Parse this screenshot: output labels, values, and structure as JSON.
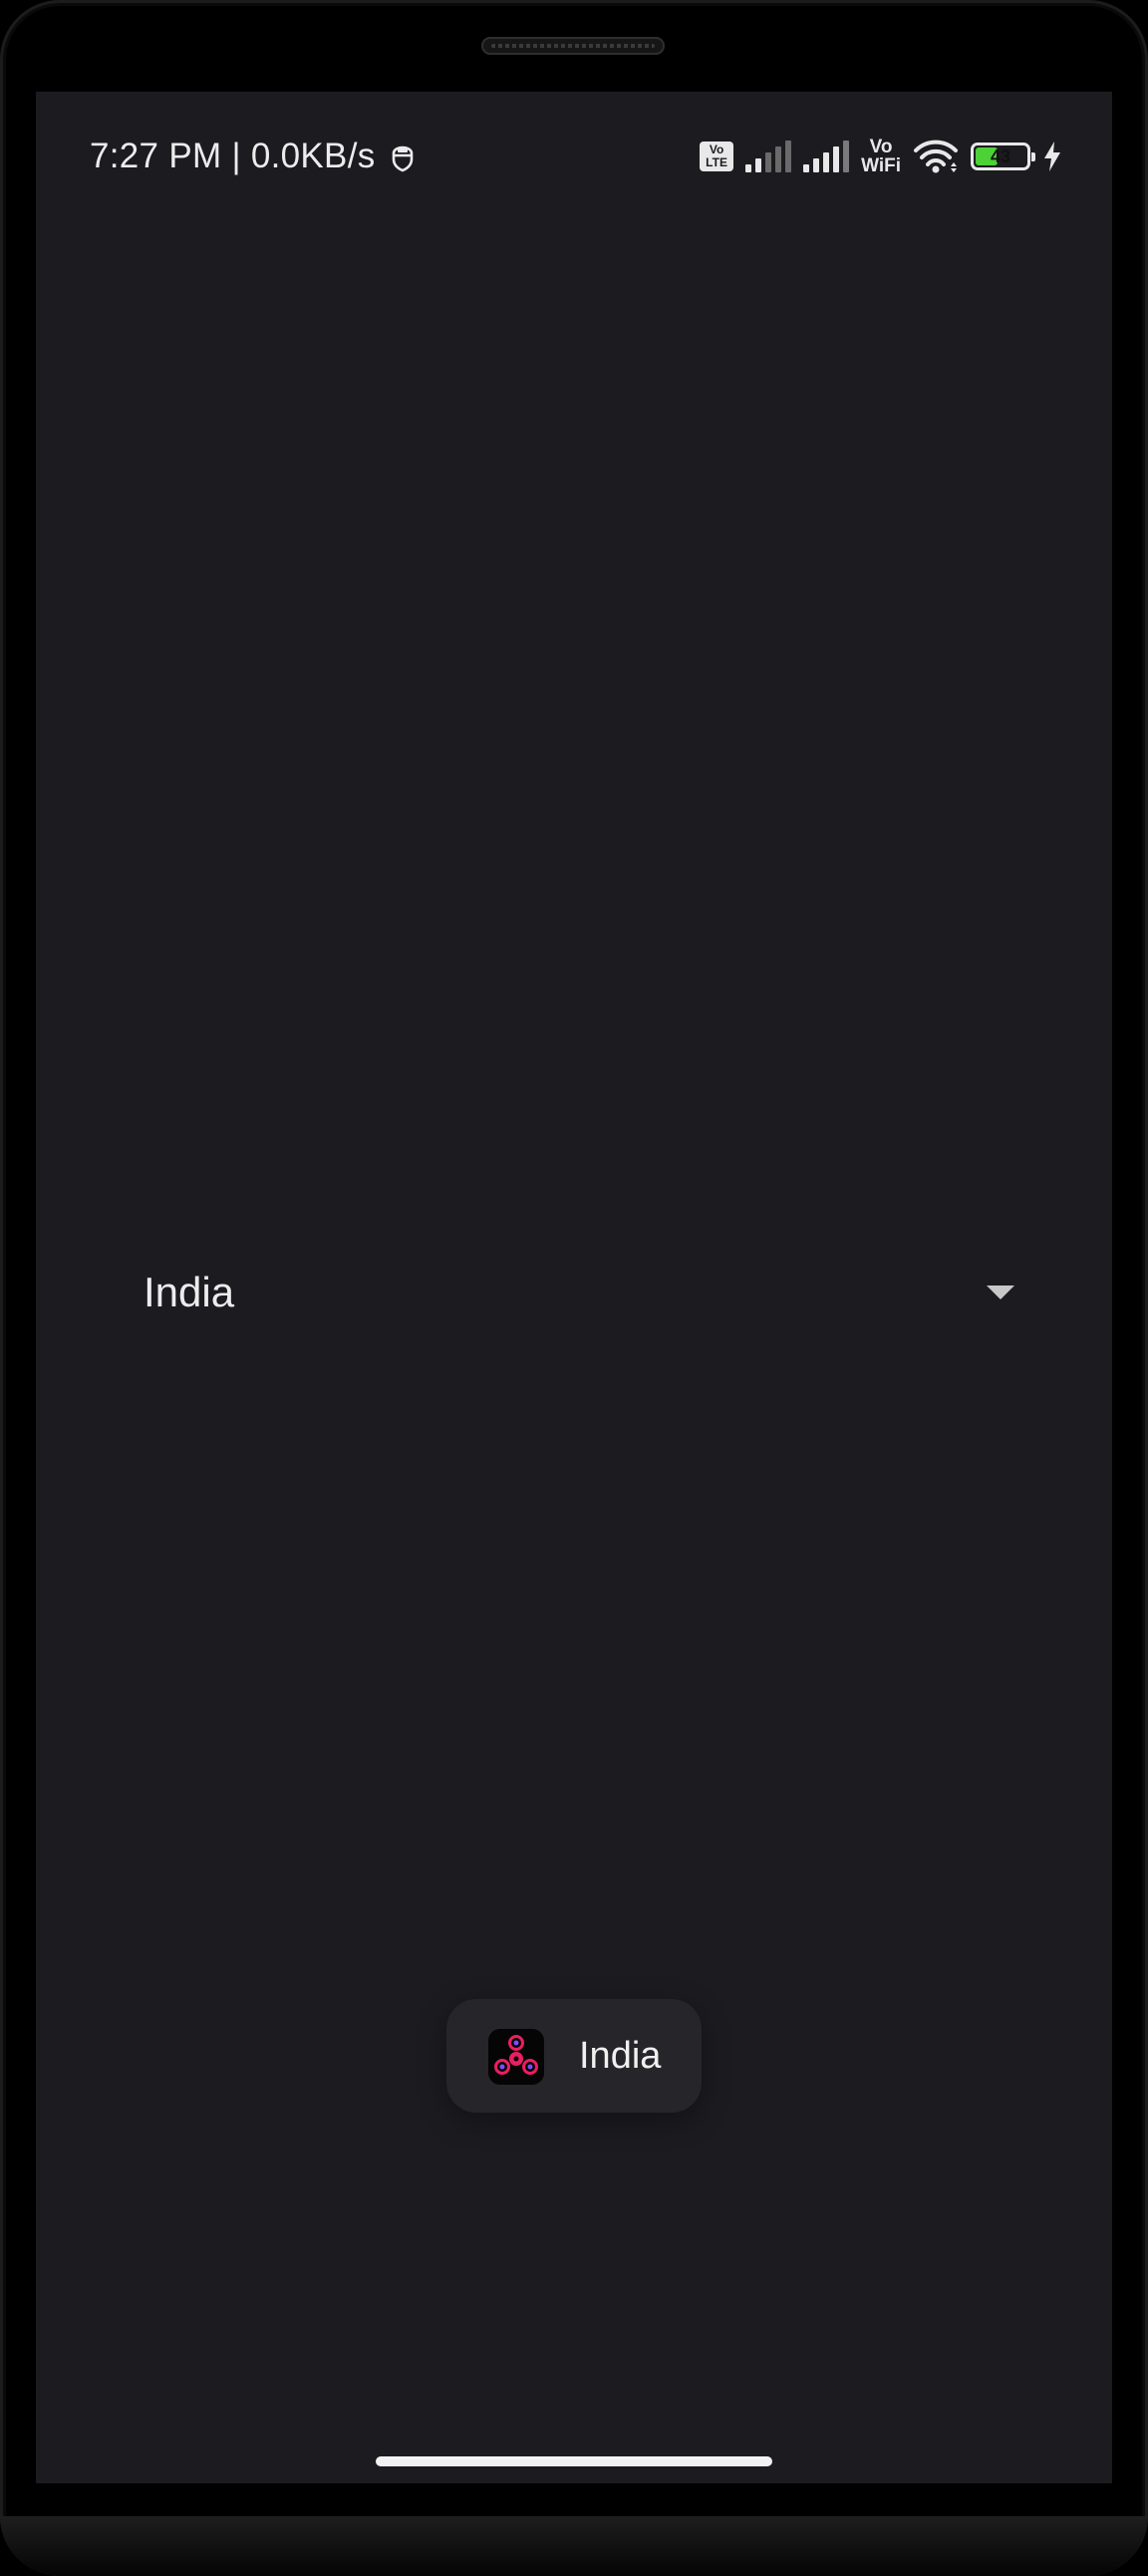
{
  "status_bar": {
    "time": "7:27 PM",
    "separator": "|",
    "net_speed": "0.0KB/s",
    "notification_icon": "user-shield-icon",
    "volte_label_1": "Vo",
    "volte_label_2": "LTE",
    "vowifi_label_1": "Vo",
    "vowifi_label_2": "WiFi",
    "battery_level": "43",
    "battery_fraction": 0.43,
    "charging": true
  },
  "spinner": {
    "selected_value": "India",
    "icon": "dropdown-arrow-icon"
  },
  "toast": {
    "app_icon": "fidget-spinner-app-icon",
    "message": "India"
  },
  "colors": {
    "screen_bg": "#1c1b20",
    "toast_bg": "#262529",
    "text": "#ececec",
    "accent": "#e91e63",
    "battery_fill": "#4cd137"
  }
}
